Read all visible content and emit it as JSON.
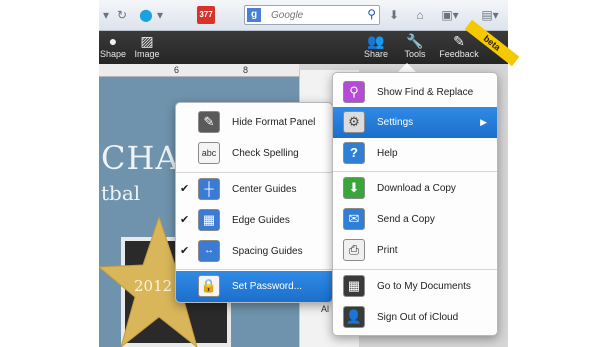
{
  "browser": {
    "search_placeholder": "Google",
    "search_engine_icon": "google-icon",
    "icons": [
      "dropdown-arrow-icon",
      "refresh-icon",
      "skype-icon",
      "calendar-icon",
      "search-engine-icon",
      "search-go-icon",
      "download-icon",
      "home-icon",
      "bookmark-icon",
      "menu-icon"
    ],
    "calendar_badge": "377"
  },
  "toolbar": {
    "shape_label": "Shape",
    "image_label": "Image",
    "share_label": "Share",
    "tools_label": "Tools",
    "feedback_label": "Feedback",
    "beta": "beta"
  },
  "ruler": {
    "mark_6": "6",
    "mark_8": "8"
  },
  "document": {
    "title_text": "CHAR",
    "subtitle_text": "tbal",
    "star_text": "2012",
    "side_label": "Al"
  },
  "settings_menu": {
    "items": [
      {
        "label": "Hide Format Panel",
        "icon": "format-brush-icon"
      },
      {
        "label": "Check Spelling",
        "icon": "spellcheck-icon",
        "icon_text": "abc"
      },
      {
        "label": "Center Guides",
        "icon": "center-guides-icon",
        "checked": true
      },
      {
        "label": "Edge Guides",
        "icon": "edge-guides-icon",
        "checked": true
      },
      {
        "label": "Spacing Guides",
        "icon": "spacing-guides-icon",
        "checked": true
      },
      {
        "label": "Set Password...",
        "icon": "lock-icon",
        "highlighted": true
      }
    ],
    "check_glyph": "✔"
  },
  "tools_menu": {
    "items": [
      {
        "label": "Show Find & Replace",
        "icon": "find-icon"
      },
      {
        "label": "Settings",
        "icon": "settings-gear-icon",
        "highlighted": true,
        "submenu_arrow": "▶"
      },
      {
        "label": "Help",
        "icon": "help-icon",
        "icon_text": "?"
      },
      {
        "label": "Download a Copy",
        "icon": "download-icon"
      },
      {
        "label": "Send a Copy",
        "icon": "mail-icon"
      },
      {
        "label": "Print",
        "icon": "printer-icon"
      },
      {
        "label": "Go to My Documents",
        "icon": "documents-grid-icon"
      },
      {
        "label": "Sign Out of iCloud",
        "icon": "user-silhouette-icon"
      }
    ]
  },
  "colors": {
    "highlight": "#1c6fcb",
    "toolbar_bg": "#2b2b2b",
    "beta_ribbon": "#f6c800",
    "canvas_blue": "#6f93ad",
    "star_gold": "#d9b65a"
  }
}
